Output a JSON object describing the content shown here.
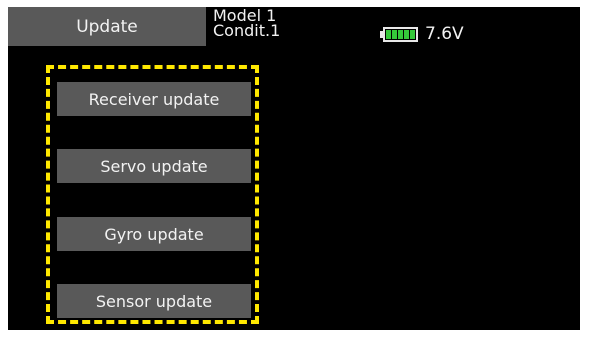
{
  "header": {
    "title": "Update",
    "model_line1": "Model 1",
    "model_line2": "Condit.1",
    "battery_voltage": "7.6V",
    "battery_icon": "battery-full-icon",
    "battery_color": "#35c93a"
  },
  "menu": {
    "items": [
      {
        "label": "Receiver update"
      },
      {
        "label": "Servo update"
      },
      {
        "label": "Gyro update"
      },
      {
        "label": "Sensor update"
      }
    ]
  },
  "colors": {
    "screen_bg": "#000000",
    "button_bg": "#595959",
    "highlight": "#ffe800"
  }
}
